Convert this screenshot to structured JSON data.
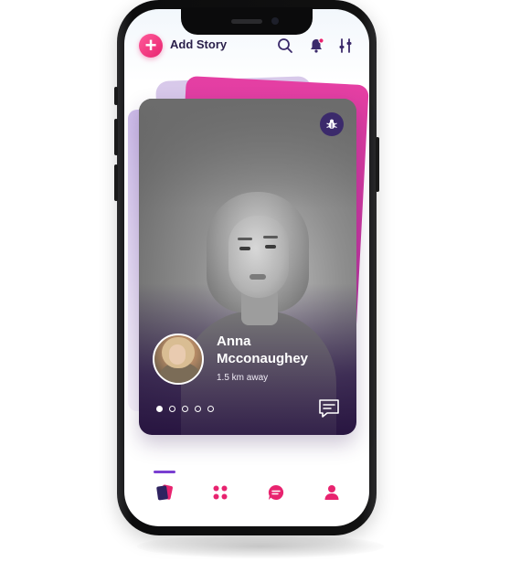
{
  "header": {
    "add_story_label": "Add Story",
    "icons": [
      "search-icon",
      "bell-icon",
      "filter-icon"
    ],
    "notification_dot_color": "#e8236f"
  },
  "card": {
    "name": "Anna Mcconaughey",
    "distance": "1.5 km away",
    "photo_index": 1,
    "photo_count": 5,
    "top_icon": "bug-icon",
    "chat_icon": "chat-icon"
  },
  "nav": {
    "items": [
      "cards-icon",
      "apps-icon",
      "messages-icon",
      "profile-icon"
    ],
    "active_index": 0,
    "active_color": "#7a3fd1"
  },
  "colors": {
    "brand_pink": "#e8236f",
    "brand_purple": "#3b2a6b",
    "card_back_pink": "#e53fa3",
    "card_back_lilac": "#d8c9ea"
  }
}
